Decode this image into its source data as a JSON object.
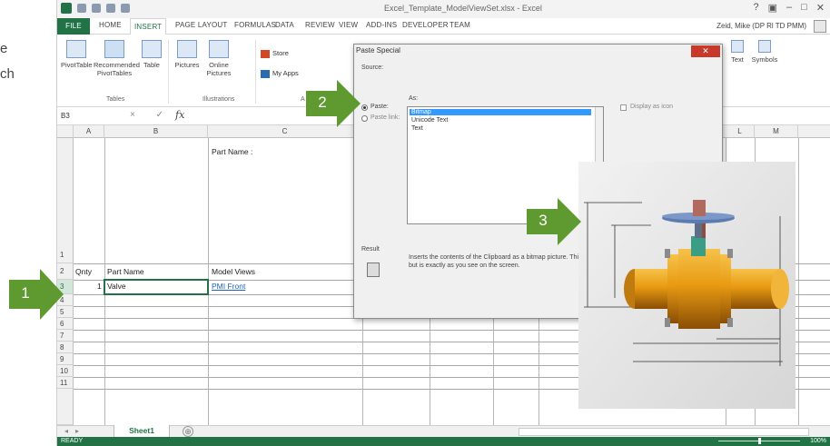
{
  "side_text": {
    "line1": "e",
    "line2": "ch"
  },
  "window": {
    "title": "Excel_Template_ModelViewSet.xlsx - Excel",
    "controls": [
      "?",
      "▣",
      "–",
      "□",
      "✕"
    ]
  },
  "tabs": [
    "FILE",
    "HOME",
    "INSERT",
    "PAGE LAYOUT",
    "FORMULAS",
    "DATA",
    "REVIEW",
    "VIEW",
    "ADD-INS",
    "DEVELOPER",
    "TEAM"
  ],
  "user": "Zeid, Mike (DP Rl TD PMM)",
  "ribbon": {
    "pivottable": "PivotTable",
    "recommended": "Recommended PivotTables",
    "table": "Table",
    "pictures": "Pictures",
    "online_pictures": "Online Pictures",
    "store": "Store",
    "my_apps": "My Apps",
    "text": "Text",
    "symbols": "Symbols",
    "group_tables": "Tables",
    "group_illustrations": "Illustrations",
    "group_apps": "A"
  },
  "formula_bar": {
    "name_box": "B3",
    "buttons": "× ✓",
    "fx": "fx",
    "value": ""
  },
  "columns": [
    {
      "label": "A"
    },
    {
      "label": "B"
    },
    {
      "label": "C"
    },
    {
      "label": "L"
    },
    {
      "label": "M"
    }
  ],
  "rows": [
    "1",
    "2",
    "3",
    "4",
    "5",
    "6",
    "7",
    "8",
    "9",
    "10",
    "11"
  ],
  "cells": {
    "part_name_label": "Part Name :",
    "header_qnty": "Qnty",
    "header_part_name": "Part Name",
    "header_model_views": "Model Views",
    "row3_qty": "1",
    "row3_name": "Valve",
    "row3_view": "PMI Front"
  },
  "sheet": {
    "tab": "Sheet1",
    "add": "⊕"
  },
  "status": {
    "left": "READY",
    "zoom": "100%"
  },
  "dialog": {
    "title": "Paste Special",
    "source_label": "Source:",
    "as_label": "As:",
    "paste_option": "Paste:",
    "paste_link_option": "Paste link:",
    "list_items": [
      "Bitmap",
      "Unicode Text",
      "Text"
    ],
    "display_as_icon": "Display as icon",
    "result_label": "Result",
    "result_text": "Inserts the contents of the Clipboard as a bitmap picture. This option, but is exactly as you see on the screen.",
    "close": "✕"
  },
  "callouts": [
    {
      "number": "1",
      "color": "#5e9a2f"
    },
    {
      "number": "2",
      "color": "#5e9a2f"
    },
    {
      "number": "3",
      "color": "#5e9a2f"
    }
  ],
  "colors": {
    "excel_green": "#217346",
    "callout_green": "#5e9a2f",
    "link_blue": "#1f5fbf",
    "valve_orange": "#e89a12"
  }
}
